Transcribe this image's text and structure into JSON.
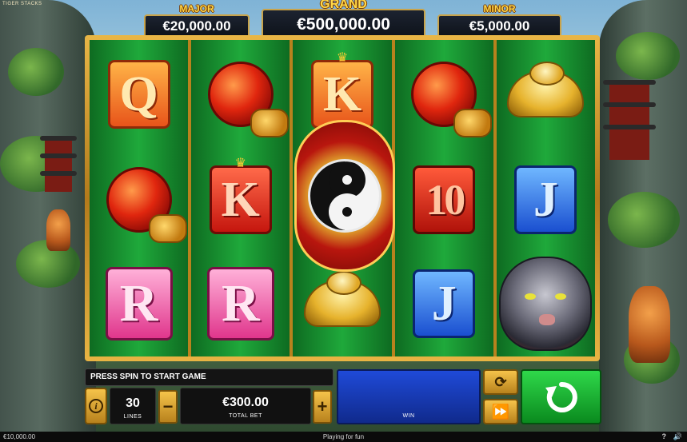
{
  "jackpots": {
    "major": {
      "label": "MAJOR",
      "value": "€20,000.00"
    },
    "grand": {
      "label": "GRAND",
      "value": "€500,000.00"
    },
    "minor": {
      "label": "MINOR",
      "value": "€5,000.00"
    }
  },
  "game_logo_text": "TIGER STACKS",
  "reels": [
    {
      "symbols": [
        "Q",
        "lantern",
        "R"
      ]
    },
    {
      "symbols": [
        "lantern",
        "K",
        "R"
      ]
    },
    {
      "symbols": [
        "K",
        "yin-yang-wild",
        "gold-ingot"
      ]
    },
    {
      "symbols": [
        "lantern",
        "10",
        "J"
      ]
    },
    {
      "symbols": [
        "gold-ingot",
        "J",
        "black-tiger"
      ]
    }
  ],
  "symbol_text": {
    "q": "Q",
    "k": "K",
    "r": "R",
    "j": "J",
    "ten": "10"
  },
  "message": "PRESS SPIN TO START GAME",
  "lines": {
    "value": "30",
    "label": "LINES"
  },
  "bet": {
    "value": "€300.00",
    "label": "TOTAL BET"
  },
  "win": {
    "label": "WIN"
  },
  "status": {
    "balance": "€10,000.00",
    "mode": "Playing for fun",
    "help": "?",
    "sound_icon": "speaker-icon"
  },
  "colors": {
    "reel_green": "#1fa93b",
    "frame_gold": "#e9b646",
    "spin_green": "#2fd84a",
    "win_blue": "#1f4ad8"
  }
}
